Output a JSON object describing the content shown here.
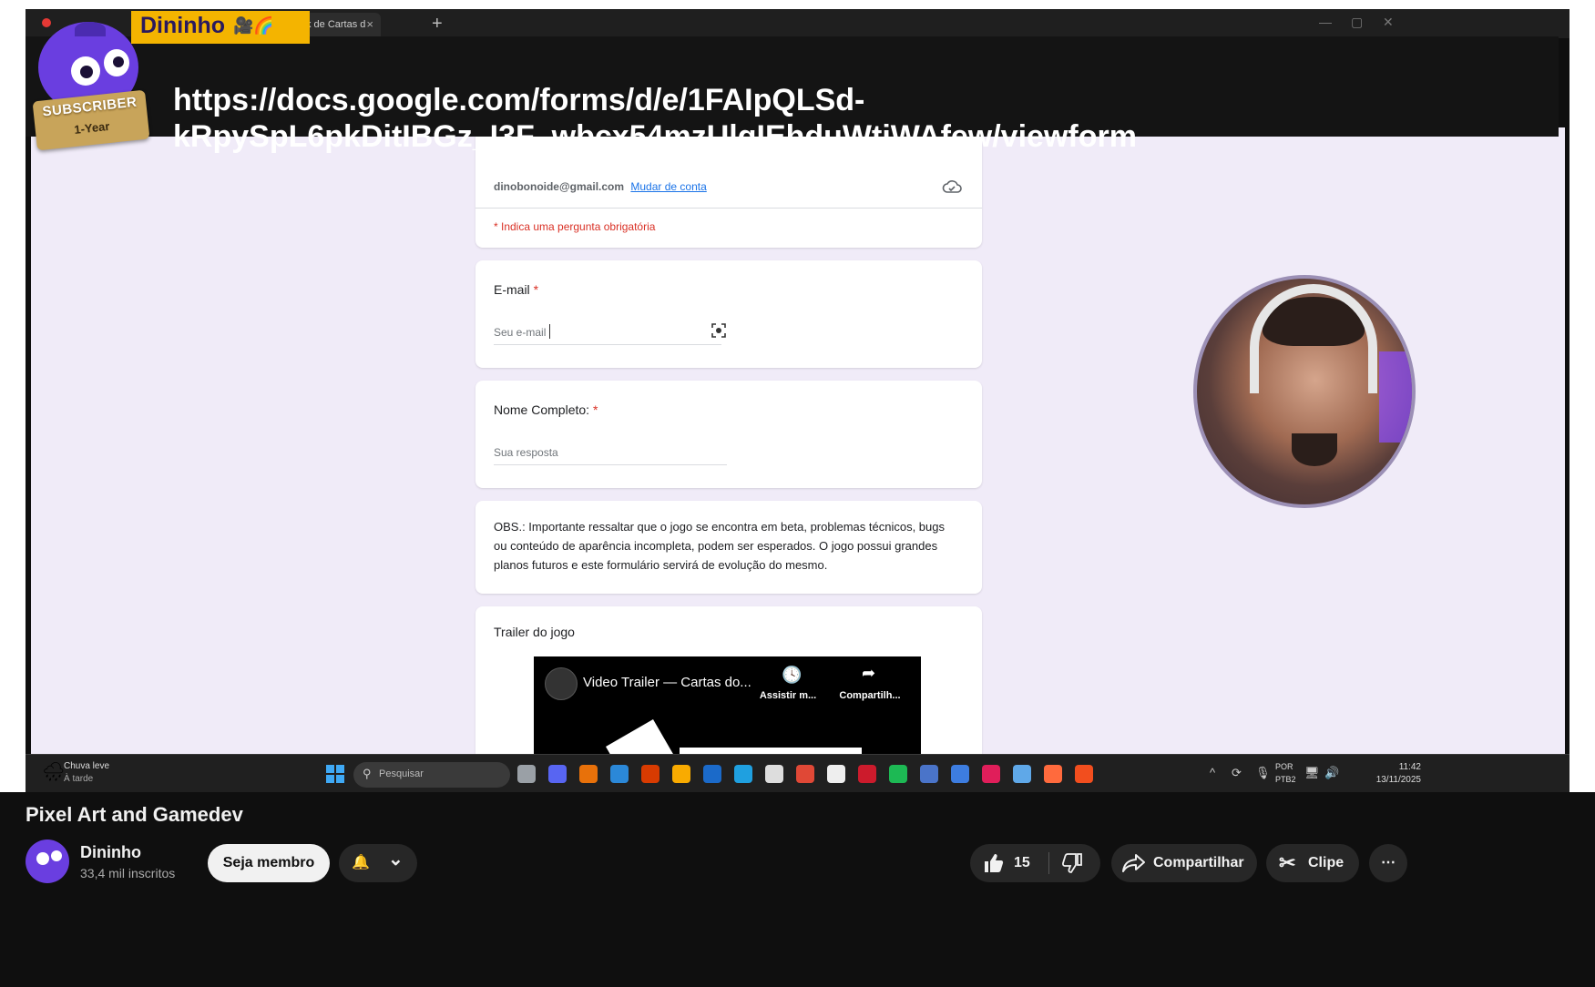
{
  "overlay": {
    "url": "https://docs.google.com/forms/d/e/1FAIpQLSd-kRpySpL6pkDitIBGz_I3F_wbcx54mzUlgIEhduWtiWAfew/viewform",
    "url_line1": "https://docs.google.com/forms/d/e/1FAIpQLSd-",
    "url_line2": "kRpySpL6pkDitIBGz_I3F_wbcx54mzUlgIEhduWtiWAfew/viewform",
    "channel_badge": "Dininho",
    "subscriber_badge_top": "SUBSCRIBER",
    "subscriber_badge_bottom": "1-Year"
  },
  "browser": {
    "tab_title": "edback de Cartas d",
    "close_glyph": "×",
    "new_tab_glyph": "+"
  },
  "form": {
    "account_email": "dinobonoide@gmail.com",
    "switch_account": "Mudar de conta",
    "required_note": "* Indica uma pergunta obrigatória",
    "q_email_label": "E-mail",
    "q_email_placeholder": "Seu e-mail",
    "q_name_label": "Nome Completo:",
    "q_name_placeholder": "Sua resposta",
    "required_mark": "*",
    "obs_text": "OBS.: Importante ressaltar que o jogo se encontra em beta, problemas técnicos, bugs ou conteúdo de aparência incompleta, podem ser esperados. O jogo possui grandes planos futuros e este formulário servirá de evolução do mesmo.",
    "trailer_label": "Trailer do jogo",
    "trailer_video_title": "Video Trailer — Cartas do...",
    "trailer_watch_later": "Assistir m...",
    "trailer_share": "Compartilh..."
  },
  "taskbar": {
    "weather_line1": "Chuva leve",
    "weather_line2": "À tarde",
    "search_placeholder": "Pesquisar",
    "lang_line1": "POR",
    "lang_line2": "PTB2",
    "time": "11:42",
    "date": "13/11/2025",
    "apps": [
      {
        "name": "file-explorer-icon",
        "color": "#9aa0a6"
      },
      {
        "name": "discord-icon",
        "color": "#5865f2"
      },
      {
        "name": "copilot-icon",
        "color": "#e8710a"
      },
      {
        "name": "store-icon",
        "color": "#2b88d8"
      },
      {
        "name": "office-icon",
        "color": "#d83b01"
      },
      {
        "name": "folder-icon",
        "color": "#f9ab00"
      },
      {
        "name": "steam-icon",
        "color": "#1b6ac9"
      },
      {
        "name": "edge-icon",
        "color": "#1fa0e0"
      },
      {
        "name": "obs-icon",
        "color": "#dddddd"
      },
      {
        "name": "chrome-icon",
        "color": "#e04836"
      },
      {
        "name": "streamdeck-icon",
        "color": "#eeeeee"
      },
      {
        "name": "opera-icon",
        "color": "#cc1b2c"
      },
      {
        "name": "spotify-icon",
        "color": "#1db954"
      },
      {
        "name": "mail-icon",
        "color": "#4a74c9"
      },
      {
        "name": "blender-icon",
        "color": "#3d7de0"
      },
      {
        "name": "slack-icon",
        "color": "#e01e5a"
      },
      {
        "name": "photos-icon",
        "color": "#5fa8e8"
      },
      {
        "name": "aseprite-icon",
        "color": "#ff6a3d"
      },
      {
        "name": "figma-icon",
        "color": "#f24e1e"
      }
    ]
  },
  "youtube": {
    "video_title": "Pixel Art and Gamedev",
    "channel_name": "Dininho",
    "subscribers": "33,4 mil inscritos",
    "join_label": "Seja membro",
    "like_count": "15",
    "share_label": "Compartilhar",
    "clip_label": "Clipe",
    "bell_glyph": "🔔",
    "chevron_glyph": "⌄",
    "more_glyph": "⋯"
  },
  "colors": {
    "form_background": "#f0ebf8",
    "required_red": "#d93025",
    "link_blue": "#1a73e8",
    "badge_yellow": "#f4b400",
    "mascot_purple": "#6a3ee0"
  }
}
